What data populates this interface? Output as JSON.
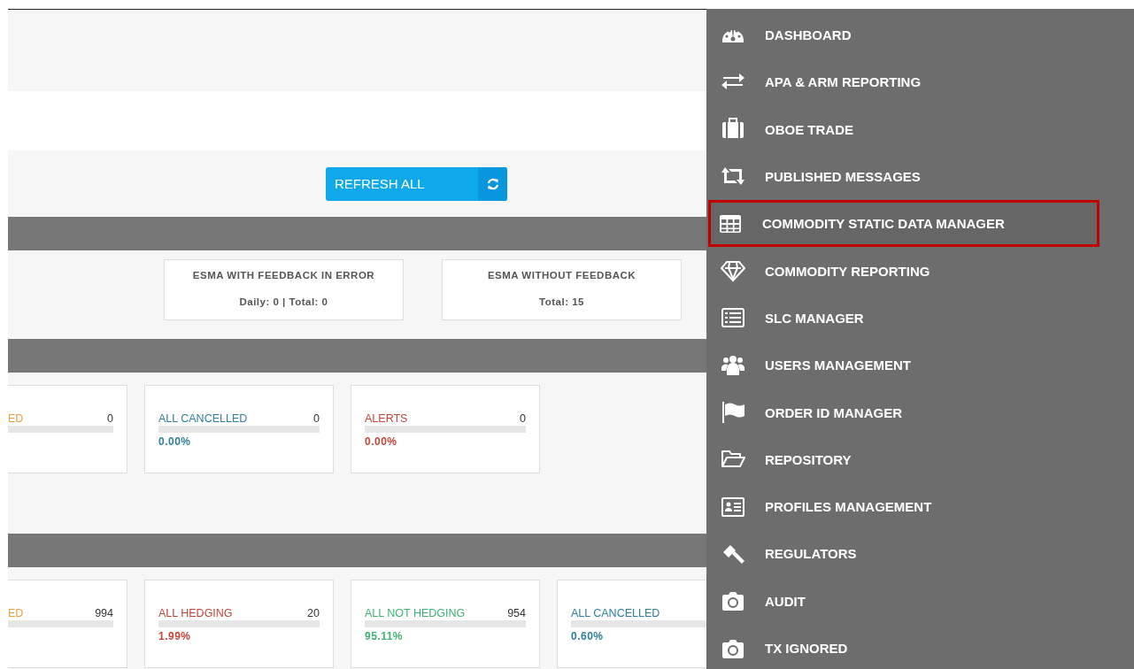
{
  "toolbar": {
    "refresh_button": {
      "label": "REFRESH ALL"
    }
  },
  "feedback_boxes": [
    {
      "title": "ESMA WITH FEEDBACK IN ERROR",
      "value": "Daily: 0 | Total: 0"
    },
    {
      "title": "ESMA WITHOUT FEEDBACK",
      "value": "Total: 15"
    }
  ],
  "card_rows": [
    {
      "cards": [
        {
          "label": "ED",
          "count": "0",
          "color": "#e8a040"
        },
        {
          "label": "ALL CANCELLED",
          "count": "0",
          "percent": "0.00%",
          "color": "#2f7f9a"
        },
        {
          "label": "ALERTS",
          "count": "0",
          "percent": "0.00%",
          "color": "#c0463a"
        }
      ]
    },
    {
      "cards": [
        {
          "label": "ED",
          "count": "994",
          "color": "#e8a040"
        },
        {
          "label": "ALL HEDGING",
          "count": "20",
          "percent": "1.99%",
          "color": "#c0463a"
        },
        {
          "label": "ALL NOT HEDGING",
          "count": "954",
          "percent": "95.11%",
          "color": "#3cb371"
        },
        {
          "label": "ALL CANCELLED",
          "percent": "0.60%",
          "color": "#2f7f9a"
        }
      ]
    }
  ],
  "nav_menu": {
    "items": [
      {
        "kind": "gauge",
        "label": "DASHBOARD",
        "selected": false
      },
      {
        "kind": "arrows",
        "label": "APA & ARM REPORTING",
        "selected": false
      },
      {
        "kind": "briefcase",
        "label": "OBOE TRADE",
        "selected": false
      },
      {
        "kind": "retweet",
        "label": "PUBLISHED MESSAGES",
        "selected": false
      },
      {
        "kind": "table",
        "label": "COMMODITY STATIC DATA MANAGER",
        "selected": true
      },
      {
        "kind": "diamond",
        "label": "COMMODITY REPORTING",
        "selected": false
      },
      {
        "kind": "list",
        "label": "SLC MANAGER",
        "selected": false
      },
      {
        "kind": "users",
        "label": "USERS MANAGEMENT",
        "selected": false
      },
      {
        "kind": "flag",
        "label": "ORDER ID MANAGER",
        "selected": false
      },
      {
        "kind": "folder",
        "label": "REPOSITORY",
        "selected": false
      },
      {
        "kind": "idcard",
        "label": "PROFILES MANAGEMENT",
        "selected": false
      },
      {
        "kind": "gavel",
        "label": "REGULATORS",
        "selected": false
      },
      {
        "kind": "camera",
        "label": "AUDIT",
        "selected": false
      },
      {
        "kind": "camera",
        "label": "TX IGNORED",
        "selected": false
      }
    ]
  }
}
